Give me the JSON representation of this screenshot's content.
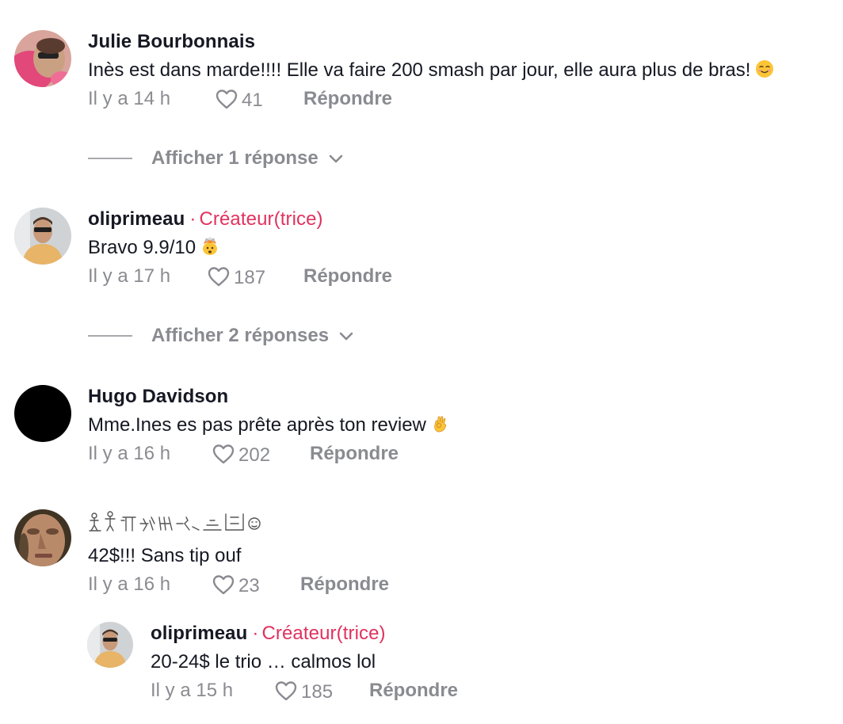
{
  "comments": [
    {
      "author": "Julie Bourbonnais",
      "text": "Inès est dans marde!!!! Elle va faire 200 smash par jour, elle aura plus de bras!",
      "emoji": "smiling-face-icon",
      "time": "Il y a 14 h",
      "likes": "41",
      "reply_label": "Répondre",
      "view_replies": "Afficher 1 réponse"
    },
    {
      "author": "oliprimeau",
      "creator_sep": "·",
      "creator_badge": "Créateur(trice)",
      "text": "Bravo 9.9/10",
      "emoji": "exploding-head-icon",
      "time": "Il y a 17 h",
      "likes": "187",
      "reply_label": "Répondre",
      "view_replies": "Afficher 2 réponses"
    },
    {
      "author": "Hugo Davidson",
      "text": "Mme.Ines es pas prête après ton review",
      "emoji": "ok-hand-icon",
      "time": "Il y a 16 h",
      "likes": "202",
      "reply_label": "Répondre"
    },
    {
      "author_icon": "decorative-glyph-name-icon",
      "text": "42$!!! Sans tip ouf",
      "time": "Il y a 16 h",
      "likes": "23",
      "reply_label": "Répondre",
      "reply": {
        "author": "oliprimeau",
        "creator_sep": "·",
        "creator_badge": "Créateur(trice)",
        "text": "20-24$ le trio … calmos lol",
        "time": "Il y a 15 h",
        "likes": "185",
        "reply_label": "Répondre"
      }
    }
  ],
  "colors": {
    "text": "#161823",
    "muted": "#8a8b91",
    "creator": "#e0325e"
  }
}
